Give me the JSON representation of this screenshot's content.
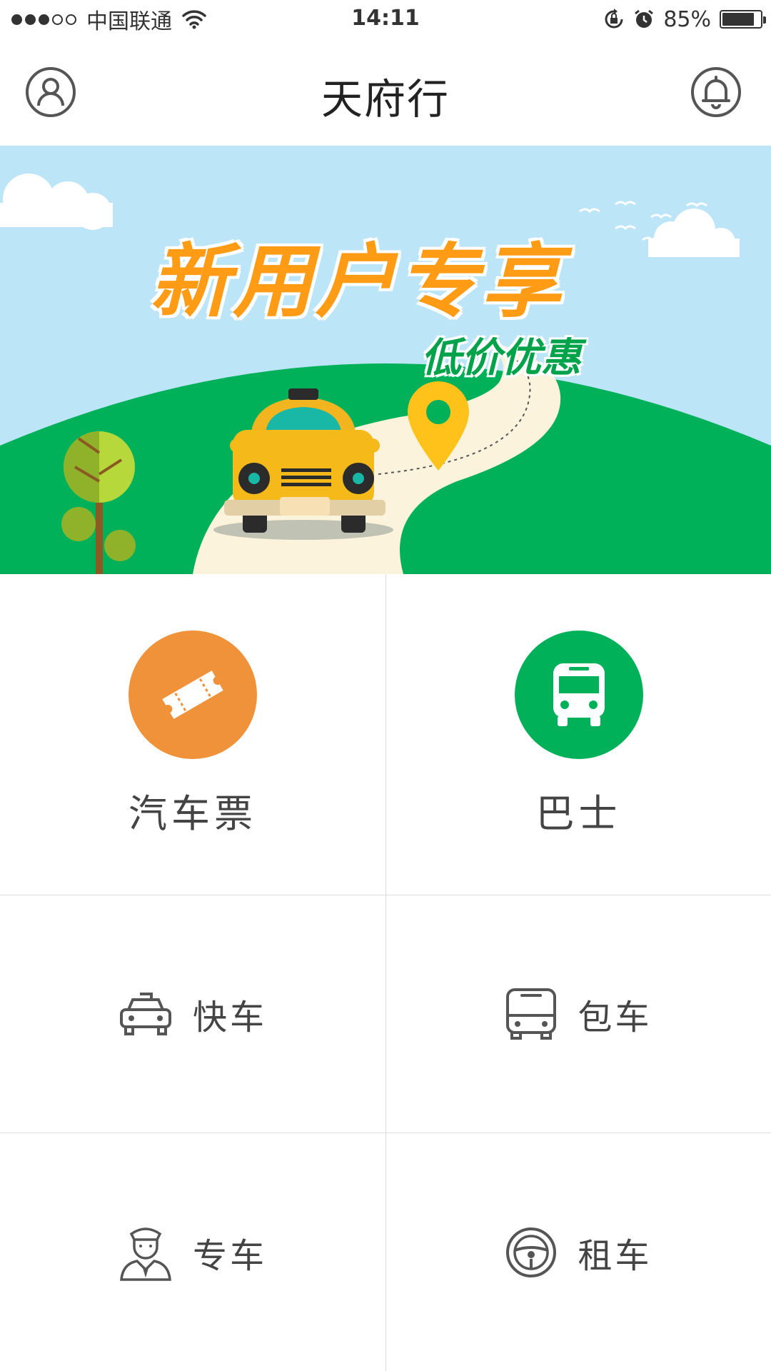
{
  "status_bar": {
    "carrier": "中国联通",
    "time": "14:11",
    "battery_percent": "85%",
    "battery_level": 0.85,
    "signal_bars_filled": 3,
    "signal_bars_total": 5
  },
  "header": {
    "title": "天府行",
    "left_icon": "user-profile-icon",
    "right_icon": "bell-icon"
  },
  "banner": {
    "title": "新用户专享",
    "subtitle": "低价优惠"
  },
  "services": {
    "bus_ticket": {
      "label": "汽车票",
      "icon": "ticket-icon",
      "color": "#f0923a"
    },
    "bus": {
      "label": "巴士",
      "icon": "bus-icon",
      "color": "#00b15a"
    },
    "express": {
      "label": "快车",
      "icon": "car-icon"
    },
    "charter": {
      "label": "包车",
      "icon": "bus-outline-icon"
    },
    "premium": {
      "label": "专车",
      "icon": "driver-icon"
    },
    "rental": {
      "label": "租车",
      "icon": "steering-wheel-icon"
    }
  },
  "colors": {
    "accent_orange": "#f0923a",
    "accent_green": "#00b15a",
    "banner_sky": "#bde5f8",
    "banner_hill": "#00b15a"
  }
}
